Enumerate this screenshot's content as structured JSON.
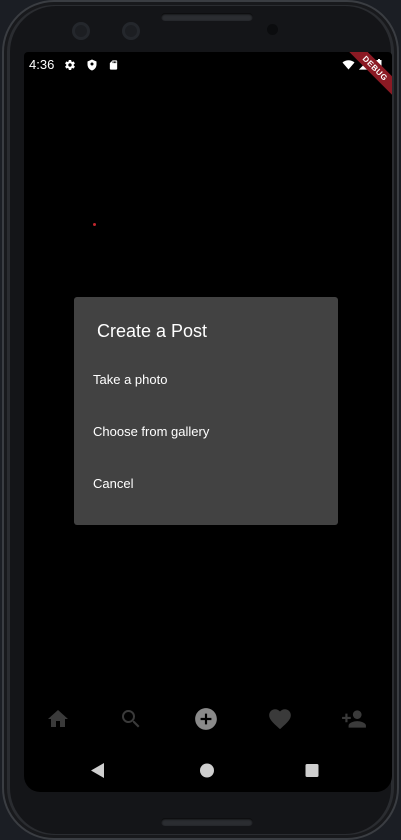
{
  "status_bar": {
    "time": "4:36",
    "debug_label": "DEBUG"
  },
  "dialog": {
    "title": "Create a Post",
    "options": [
      {
        "label": "Take a photo"
      },
      {
        "label": "Choose from gallery"
      },
      {
        "label": "Cancel"
      }
    ]
  },
  "bottom_nav": {
    "items": [
      {
        "icon": "home-icon"
      },
      {
        "icon": "search-icon"
      },
      {
        "icon": "add-circle-icon"
      },
      {
        "icon": "heart-icon"
      },
      {
        "icon": "add-person-icon"
      }
    ]
  },
  "colors": {
    "screen_background": "#000000",
    "dialog_background": "#424242",
    "nav_icon_inactive": "#3a3a3a",
    "nav_icon_active": "#8a8a8a",
    "debug_banner": "#8b1a24"
  }
}
